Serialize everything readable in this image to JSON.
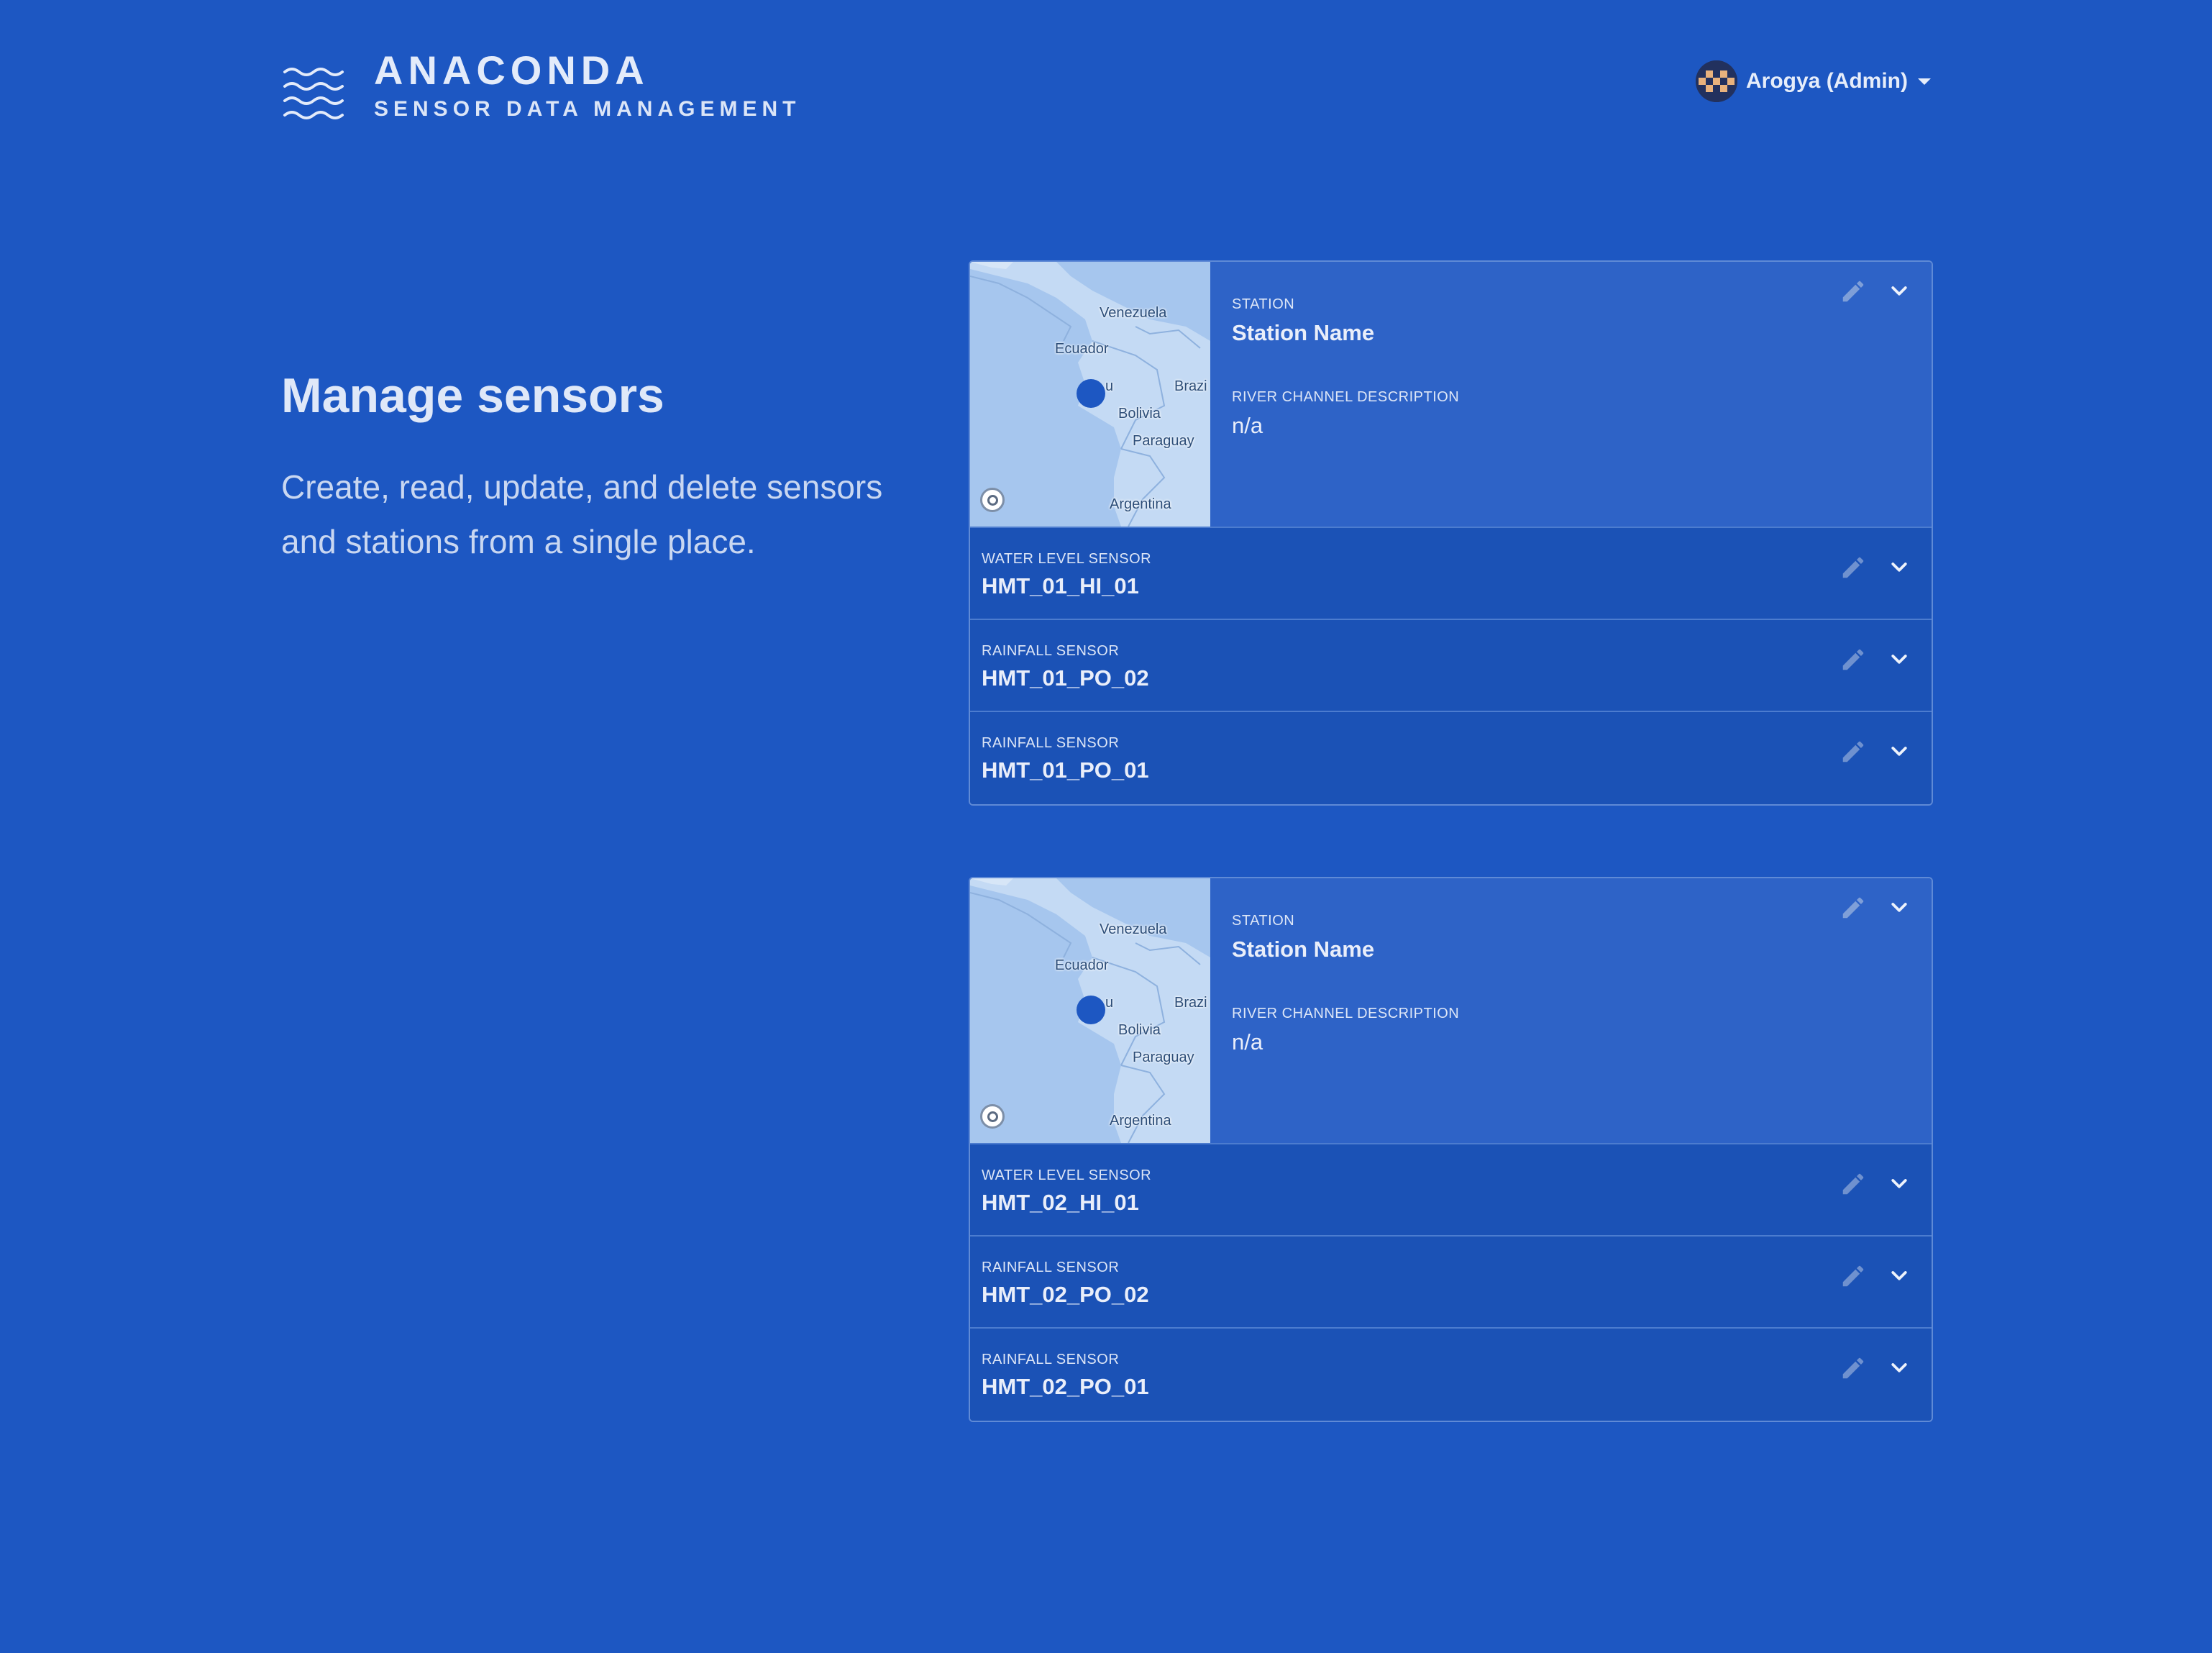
{
  "header": {
    "brand_title": "ANACONDA",
    "brand_subtitle": "SENSOR DATA MANAGEMENT",
    "logo_icon": "waves-icon",
    "user_name": "Arogya (Admin)"
  },
  "intro": {
    "title": "Manage sensors",
    "description": "Create, read, update, and delete sensors and stations from a single place."
  },
  "colors": {
    "background": "#1d57c2",
    "station_header": "#2e63c7",
    "sensor_row": "#1b52b6",
    "marker": "#1d57c2"
  },
  "map_labels": {
    "venezuela": "Venezuela",
    "ecuador": "Ecuador",
    "peru_partial": "u",
    "brazil": "Brazi",
    "bolivia": "Bolivia",
    "paraguay": "Paraguay",
    "argentina": "Argentina"
  },
  "stations": [
    {
      "station_label": "STATION",
      "station_name": "Station Name",
      "description_label": "RIVER CHANNEL DESCRIPTION",
      "description_value": "n/a",
      "sensors": [
        {
          "type": "WATER LEVEL SENSOR",
          "id": "HMT_01_HI_01"
        },
        {
          "type": "RAINFALL SENSOR",
          "id": "HMT_01_PO_02"
        },
        {
          "type": "RAINFALL SENSOR",
          "id": "HMT_01_PO_01"
        }
      ]
    },
    {
      "station_label": "STATION",
      "station_name": "Station Name",
      "description_label": "RIVER CHANNEL DESCRIPTION",
      "description_value": "n/a",
      "sensors": [
        {
          "type": "WATER LEVEL SENSOR",
          "id": "HMT_02_HI_01"
        },
        {
          "type": "RAINFALL SENSOR",
          "id": "HMT_02_PO_02"
        },
        {
          "type": "RAINFALL SENSOR",
          "id": "HMT_02_PO_01"
        }
      ]
    }
  ]
}
